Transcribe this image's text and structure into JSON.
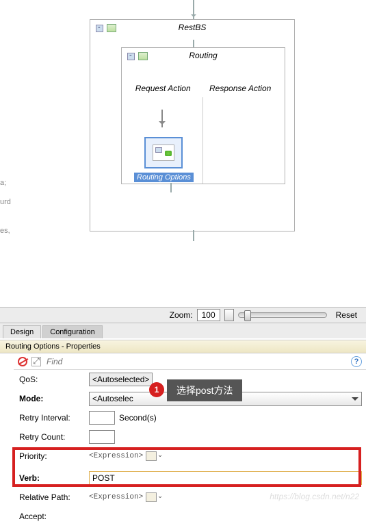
{
  "canvas": {
    "restbs_title": "RestBS",
    "routing_title": "Routing",
    "request_action": "Request Action",
    "response_action": "Response Action",
    "selected_node_label": "Routing Options"
  },
  "left_strip": {
    "a": "a;",
    "b": "urd",
    "c": "es,"
  },
  "zoom": {
    "label": "Zoom:",
    "value": "100",
    "reset": "Reset"
  },
  "tabs": {
    "design": "Design",
    "configuration": "Configuration"
  },
  "panel": {
    "title": "Routing Options - Properties",
    "find_placeholder": "Find"
  },
  "form": {
    "qos_label": "QoS:",
    "qos_value": "<Autoselected>",
    "mode_label": "Mode:",
    "mode_value": "<Autoselec",
    "retry_interval_label": "Retry Interval:",
    "retry_interval_value": "",
    "seconds_label": "Second(s)",
    "retry_count_label": "Retry Count:",
    "retry_count_value": "",
    "priority_label": "Priority:",
    "priority_value": "<Expression>",
    "verb_label": "Verb:",
    "verb_value": "POST",
    "relative_path_label": "Relative Path:",
    "relative_path_value": "<Expression>",
    "accept_label": "Accept:"
  },
  "annotation": {
    "number": "1",
    "text": "选择post方法"
  },
  "watermark": "https://blog.csdn.net/n22"
}
